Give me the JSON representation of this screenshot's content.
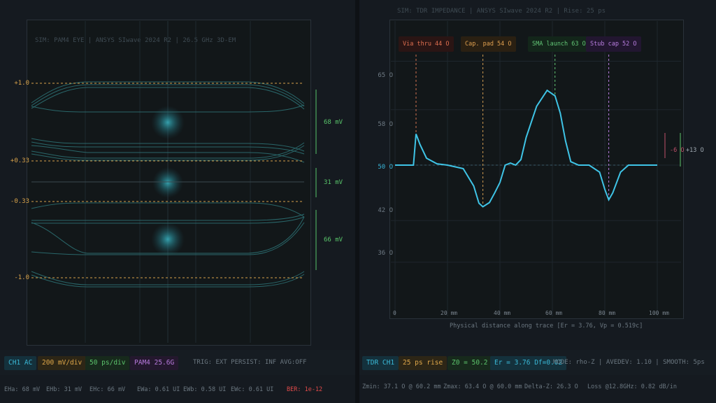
{
  "eye": {
    "sim_label": "SIM: PAM4 EYE | ANSYS SIwave 2024 R2 | 26.5 GHz 3D-EM",
    "levels": [
      "+1.0",
      "+0.33",
      "-0.33",
      "-1.0"
    ],
    "heights": [
      "68 mV",
      "31 mV",
      "66 mV"
    ],
    "chips": [
      "CH1 AC",
      "200 mV/div",
      "50 ps/div",
      "PAM4 25.6G"
    ],
    "trig": "TRIG: EXT PERSIST: INF AVG:OFF",
    "stats": [
      "EHa: 68 mV",
      "EHb: 31 mV",
      "EHc: 66 mV",
      "EWa: 0.61 UI",
      "EWb: 0.58 UI",
      "EWc: 0.61 UI"
    ],
    "ber": "BER: 1e-12"
  },
  "tdr": {
    "sim_label": "SIM: TDR IMPEDANCE | ANSYS SIwave 2024 R2 | Rise: 25 ps",
    "annotations": [
      "Via thru 44 O",
      "Cap. pad 54 O",
      "SMA launch 63 O",
      "Stub cap 52 O"
    ],
    "tolerance": [
      "-6 O",
      "+13 O"
    ],
    "chips": [
      "TDR CH1",
      "25 ps rise",
      "Z0 = 50.2 O",
      "Er = 3.76 Df=0.02"
    ],
    "mode": "MODE: rho-Z | AVEDEV: 1.10 | SMOOTH: 5ps",
    "stats": [
      "Zmin: 37.1 O @ 60.2 mm",
      "Zmax: 63.4 O @ 60.0 mm",
      "Delta-Z: 26.3 O",
      "Loss @12.8GHz: 0.82 dB/in"
    ]
  },
  "chart_data": {
    "type": "line",
    "xlabel": "Physical distance along trace [Er = 3.76, Vp = 0.519c]",
    "ylabel": "",
    "x_ticks": [
      "0",
      "20 mm",
      "40 mm",
      "60 mm",
      "80 mm",
      "100 mm"
    ],
    "y_ticks": [
      "65 O",
      "58 O",
      "50 O",
      "42 O",
      "36 O"
    ],
    "xlim": [
      0,
      100
    ],
    "ylim": [
      28,
      71
    ],
    "reference_z": 50,
    "series": [
      {
        "x": [
          0,
          4,
          7,
          8,
          9.5,
          12,
          16,
          20,
          26,
          30,
          32,
          33.5,
          36,
          38,
          40,
          42,
          44,
          46,
          48,
          50,
          54,
          58,
          61,
          63,
          65,
          67,
          70,
          74,
          78,
          80,
          81.5,
          83,
          86,
          89,
          92,
          96,
          100
        ],
        "y": [
          50,
          50,
          50,
          54.5,
          53,
          51,
          50.2,
          50,
          49.5,
          47,
          44.5,
          44,
          44.6,
          46,
          47.5,
          50,
          50.3,
          50,
          50.8,
          54,
          58.5,
          60.8,
          60,
          57.5,
          53.5,
          50.5,
          50,
          50,
          49,
          46.5,
          45,
          46,
          49,
          50,
          50,
          50,
          50
        ]
      }
    ]
  }
}
